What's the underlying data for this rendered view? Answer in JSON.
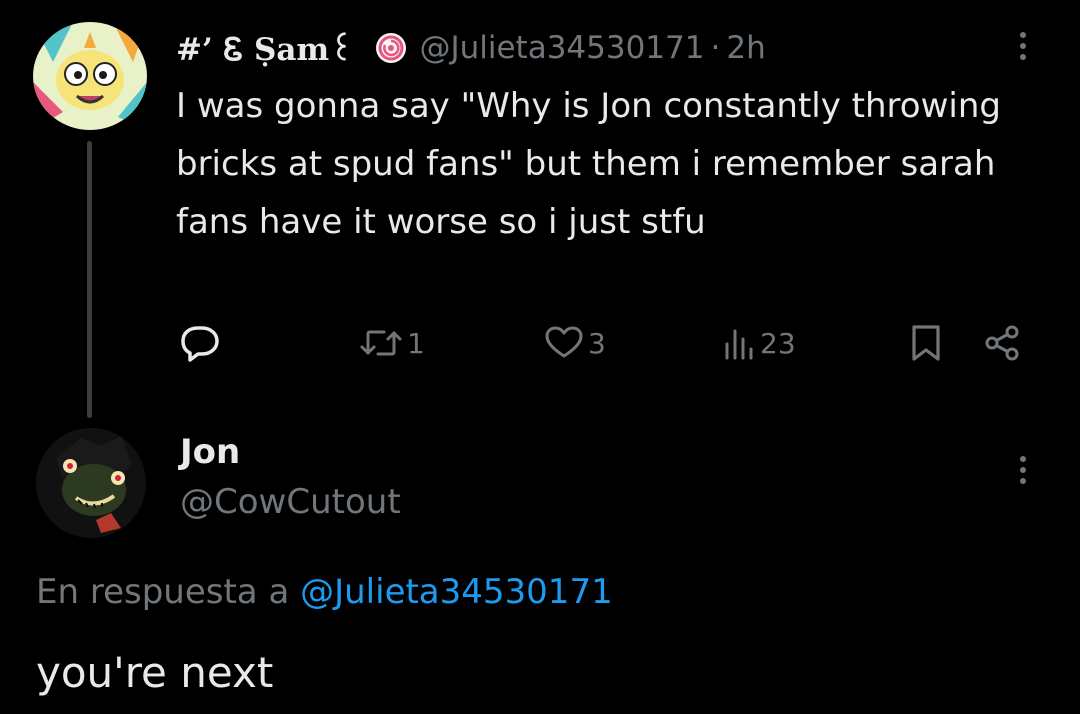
{
  "tweet1": {
    "author_name": "#’ Ꮛ Ṣam꒰",
    "handle": "@Julieta34530171",
    "separator": "·",
    "time": "2h",
    "text": "I was gonna say \"Why is Jon constantly throwing bricks at spud fans\" but them i remember sarah fans have it worse so i just stfu",
    "actions": {
      "reply_count": "",
      "retweet_count": "1",
      "like_count": "3",
      "views_count": "23"
    }
  },
  "tweet2": {
    "author_name": "Jon",
    "handle": "@CowCutout",
    "replying_prefix": "En respuesta a",
    "replying_to": "@Julieta34530171",
    "text": "you're next"
  },
  "icons": {
    "reply": "reply-icon",
    "retweet": "retweet-icon",
    "like": "heart-icon",
    "views": "views-icon",
    "bookmark": "bookmark-icon",
    "share": "share-icon",
    "more": "more-vertical-icon",
    "badge": "badge-icon"
  },
  "colors": {
    "background": "#000000",
    "text": "#e7e9ea",
    "secondary": "#71767b",
    "link": "#1d9bf0"
  }
}
